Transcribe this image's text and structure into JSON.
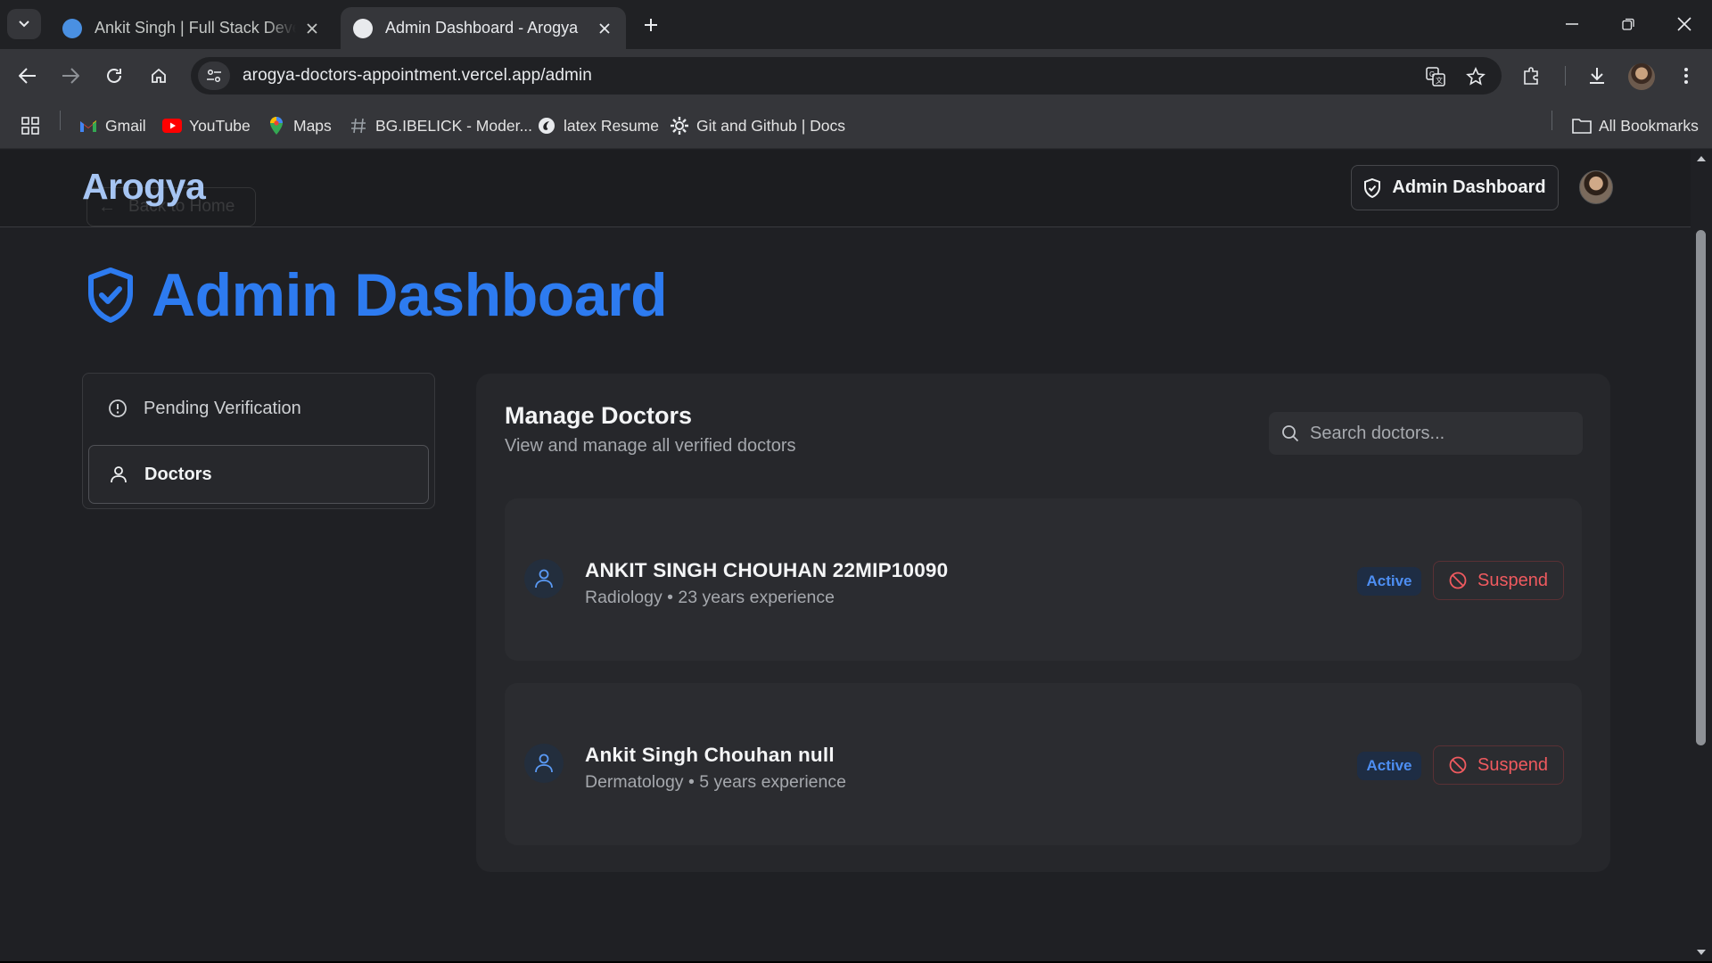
{
  "browser": {
    "tabs": [
      {
        "title": "Ankit Singh | Full Stack Develop",
        "active": false
      },
      {
        "title": "Admin Dashboard - Arogya",
        "active": true
      }
    ],
    "url": "arogya-doctors-appointment.vercel.app/admin",
    "bookmarks": [
      {
        "label": "Gmail",
        "icon": "gmail-icon"
      },
      {
        "label": "YouTube",
        "icon": "youtube-icon"
      },
      {
        "label": "Maps",
        "icon": "maps-icon"
      },
      {
        "label": "BG.IBELICK - Moder...",
        "icon": "hash-icon"
      },
      {
        "label": "latex Resume",
        "icon": "overleaf-icon"
      },
      {
        "label": "Git and Github | Docs",
        "icon": "gear-icon"
      }
    ],
    "all_bookmarks_label": "All Bookmarks"
  },
  "header": {
    "brand": "Arogya",
    "back_label": "Back to Home",
    "admin_button": "Admin Dashboard"
  },
  "page": {
    "title": "Admin Dashboard"
  },
  "sidebar": {
    "items": [
      {
        "label": "Pending Verification",
        "icon": "alert-circle-icon",
        "active": false
      },
      {
        "label": "Doctors",
        "icon": "user-icon",
        "active": true
      }
    ]
  },
  "main": {
    "title": "Manage Doctors",
    "subtitle": "View and manage all verified doctors",
    "search_placeholder": "Search doctors...",
    "doctors": [
      {
        "name": "ANKIT SINGH CHOUHAN 22MIP10090",
        "meta": "Radiology • 23 years experience",
        "status": "Active",
        "action": "Suspend"
      },
      {
        "name": "Ankit Singh Chouhan null",
        "meta": "Dermatology • 5 years experience",
        "status": "Active",
        "action": "Suspend"
      }
    ]
  },
  "colors": {
    "accent": "#2d7bf0",
    "brand": "#a6c5f3",
    "danger": "#f05a5f",
    "badge_text": "#4d8ef2"
  }
}
